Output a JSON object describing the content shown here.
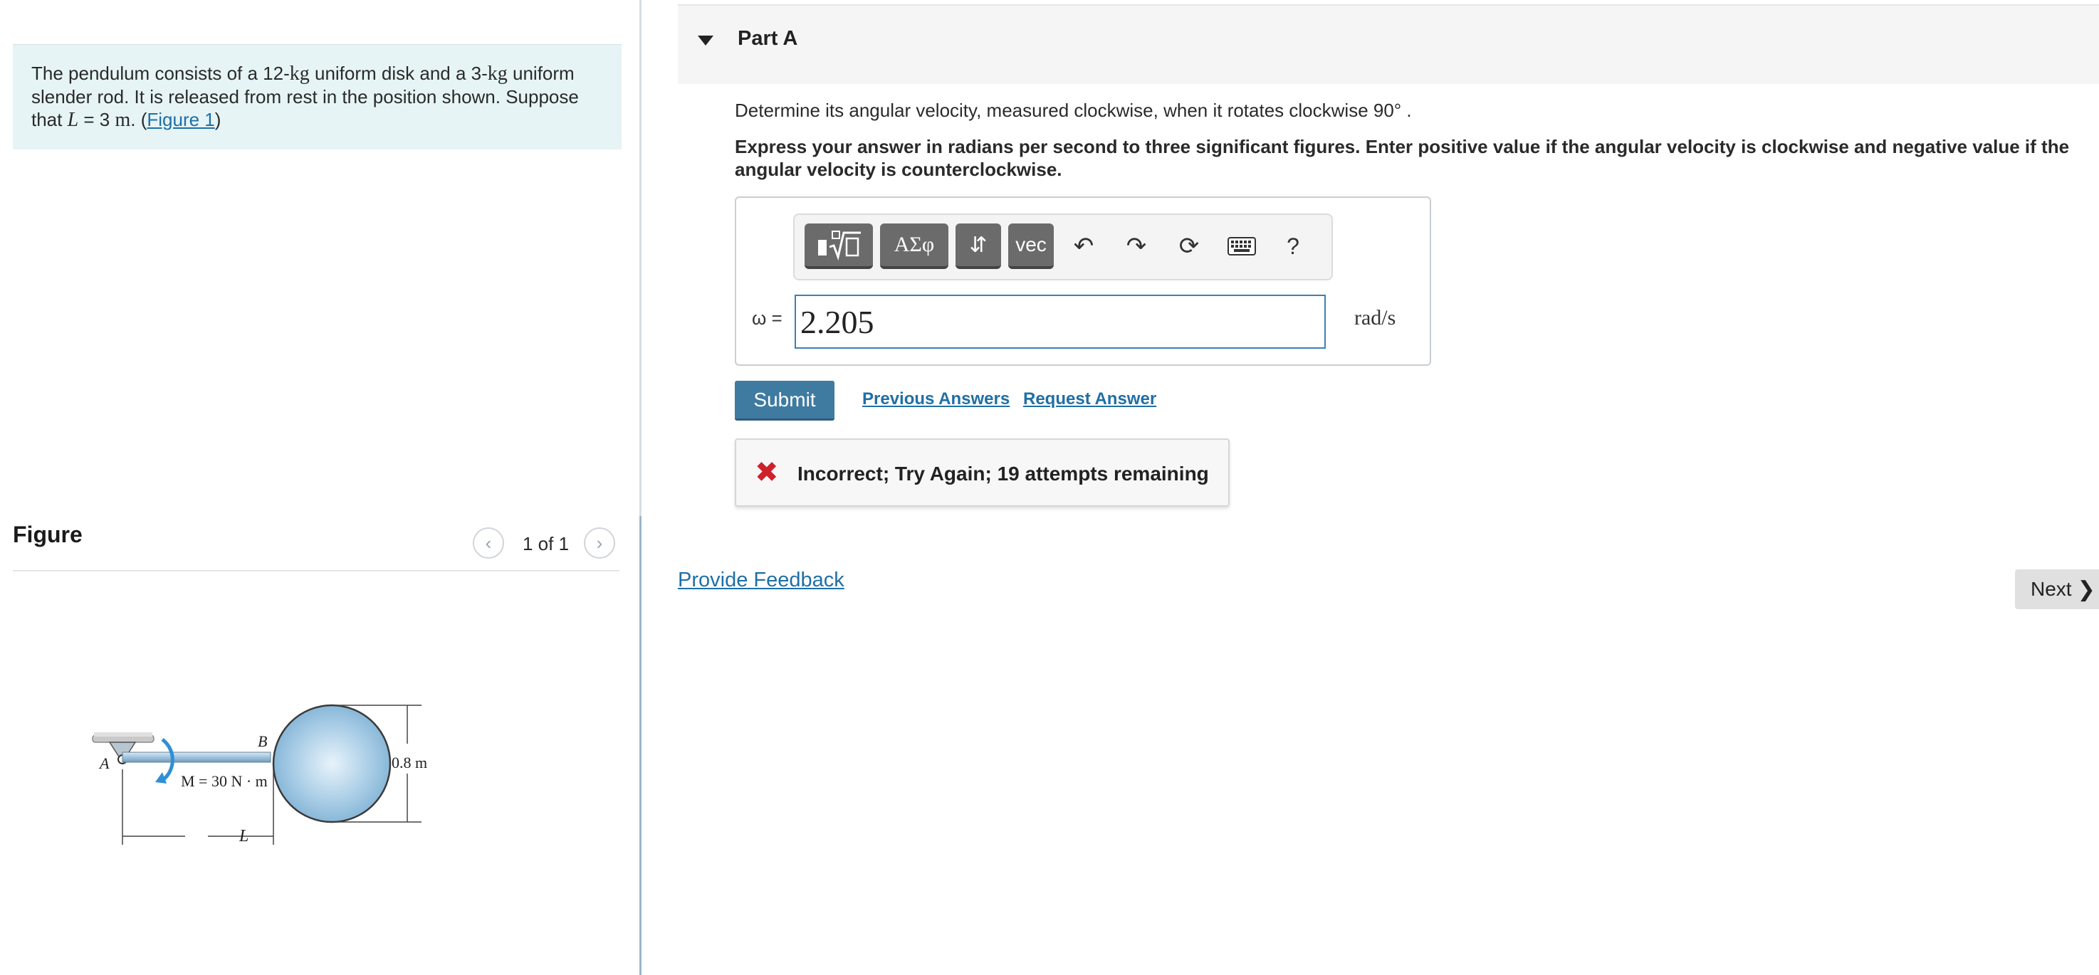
{
  "problem": {
    "text_1": "The pendulum consists of a 12-",
    "unit_kg": "kg",
    "text_2": " uniform disk and a 3-",
    "text_3": " uniform slender rod. It is released from rest in the position shown. Suppose that ",
    "var_L": "L",
    "text_4": " = 3 ",
    "unit_m": "m",
    "text_5": ". (",
    "figure_link": "Figure 1",
    "text_6": ")"
  },
  "figure": {
    "title": "Figure",
    "count": "1 of 1",
    "labels": {
      "point_a": "A",
      "point_b": "B",
      "moment": "M = 30 N · m",
      "length": "L",
      "diameter": "0.8 m"
    }
  },
  "part": {
    "title": "Part A",
    "question": "Determine its angular velocity, measured clockwise, when it rotates clockwise 90° .",
    "instructions": "Express your answer in radians per second to three significant figures. Enter positive value if the angular velocity is clockwise and negative value if the angular velocity is counterclockwise."
  },
  "toolbar": {
    "templates_icon": "templates-icon",
    "greek_label": "ΑΣφ",
    "arrows_label": "⇵",
    "vec_label": "vec",
    "undo_icon": "undo-icon",
    "redo_icon": "redo-icon",
    "reset_icon": "reset-icon",
    "keyboard_icon": "keyboard-icon",
    "help_label": "?"
  },
  "answer": {
    "variable_label": "ω =",
    "value": "2.205",
    "unit": "rad/s"
  },
  "actions": {
    "submit": "Submit",
    "previous_answers": "Previous Answers",
    "request_answer": "Request Answer"
  },
  "feedback": {
    "message": "Incorrect; Try Again; 19 attempts remaining",
    "status_color": "#d0202a"
  },
  "footer": {
    "provide_feedback": "Provide Feedback",
    "next": "Next"
  },
  "colors": {
    "accent": "#3f7ba1",
    "link": "#1f6fa6",
    "problem_bg": "#e6f4f5"
  }
}
